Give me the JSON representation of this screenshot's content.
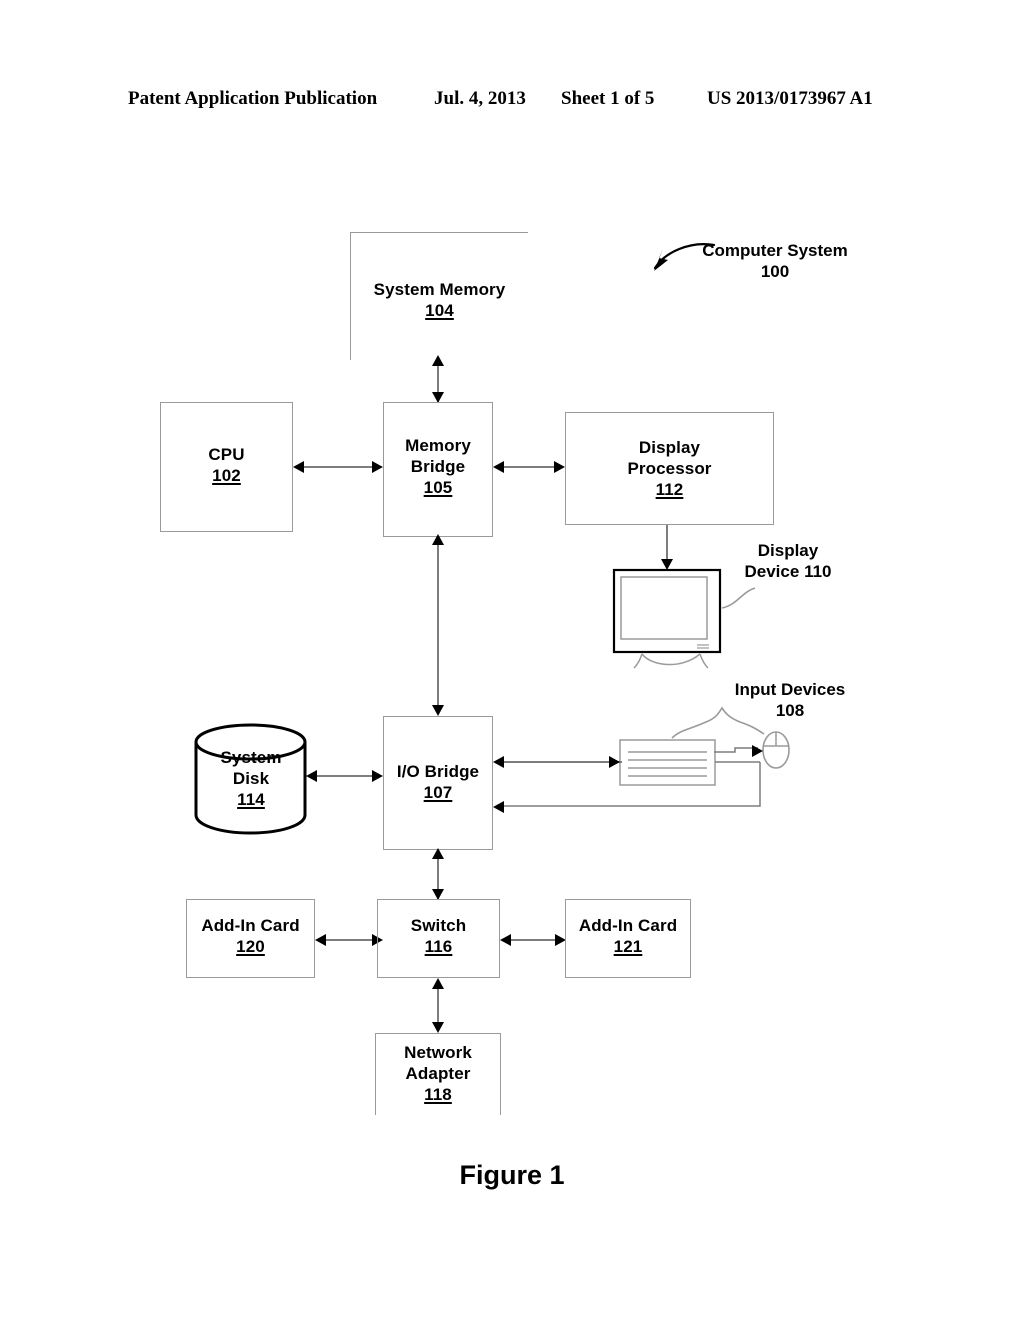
{
  "header": {
    "publication": "Patent Application Publication",
    "date": "Jul. 4, 2013",
    "sheet": "Sheet 1 of 5",
    "patent_number": "US 2013/0173967 A1"
  },
  "figure": {
    "caption": "Figure 1",
    "title_label": "Computer System",
    "title_ref": "100"
  },
  "blocks": {
    "system_memory": {
      "line1": "System Memory",
      "ref": "104"
    },
    "cpu": {
      "line1": "CPU",
      "ref": "102"
    },
    "memory_bridge": {
      "line1": "Memory",
      "line2": "Bridge",
      "ref": "105"
    },
    "display_processor": {
      "line1": "Display",
      "line2": "Processor",
      "ref": "112"
    },
    "display_device": {
      "line1": "Display",
      "line2": "Device",
      "ref": "110"
    },
    "input_devices": {
      "line1": "Input Devices",
      "ref": "108"
    },
    "system_disk": {
      "line1": "System",
      "line2": "Disk",
      "ref": "114"
    },
    "io_bridge": {
      "line1": "I/O Bridge",
      "ref": "107"
    },
    "add_in_card_120": {
      "line1": "Add-In Card",
      "ref": "120"
    },
    "switch": {
      "line1": "Switch",
      "ref": "116"
    },
    "add_in_card_121": {
      "line1": "Add-In Card",
      "ref": "121"
    },
    "network_adapter": {
      "line1": "Network",
      "line2": "Adapter",
      "ref": "118"
    }
  },
  "colors": {
    "ink": "#000000",
    "line": "#7d7d7d",
    "box_border": "#9a9a9a",
    "page": "#ffffff"
  }
}
